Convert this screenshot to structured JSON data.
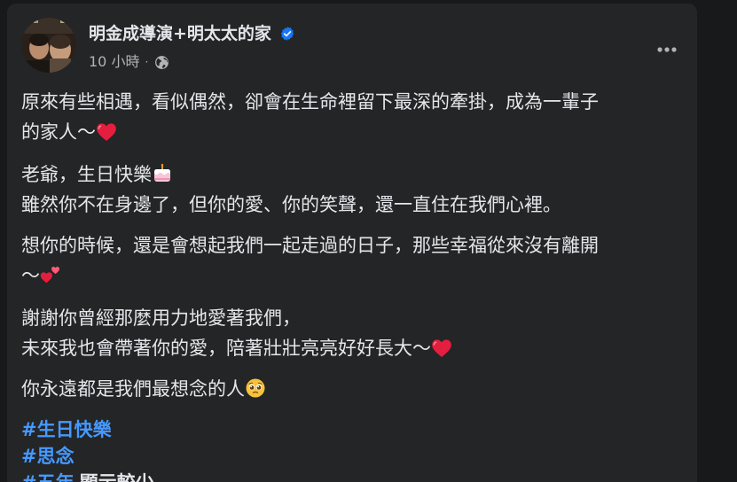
{
  "post": {
    "author": "明金成導演+明太太的家",
    "time": "10 小時",
    "meta_separator": "·",
    "privacy_icon": "globe-icon",
    "verified_icon": "verified-badge-icon",
    "more_icon": "more-horizontal-icon"
  },
  "content": {
    "p1_line1": "原來有些相遇，看似偶然，卻會在生命裡留下最深的牽掛，成為一輩子",
    "p1_line2": "的家人～",
    "p2_line1": "老爺，生日快樂",
    "p2_line2": "雖然你不在身邊了，但你的愛、你的笑聲，還一直住在我們心裡。",
    "p3_line1": "想你的時候，還是會想起我們一起走過的日子，那些幸福從來沒有離開",
    "p3_line2": "～",
    "p4_line1": "謝謝你曾經那麼用力地愛著我們，",
    "p4_line2": "未來我也會帶著你的愛，陪著壯壯亮亮好好長大～",
    "p5_line1": "你永遠都是我們最想念的人"
  },
  "emojis": {
    "heart": "red-heart-icon",
    "cake": "birthday-cake-icon",
    "two_hearts": "two-hearts-icon",
    "pleading": "pleading-face-icon"
  },
  "hashtags": {
    "tag1": "#生日快樂",
    "tag2": "#思念",
    "tag3": "#五年",
    "see_less": "顯示較少"
  },
  "colors": {
    "page_bg": "#18191a",
    "card_bg": "#242526",
    "primary_text": "#e4e6eb",
    "secondary_text": "#b0b3b8",
    "link": "#4599ff",
    "verified": "#1877f2",
    "heart": "#e41e3f"
  }
}
